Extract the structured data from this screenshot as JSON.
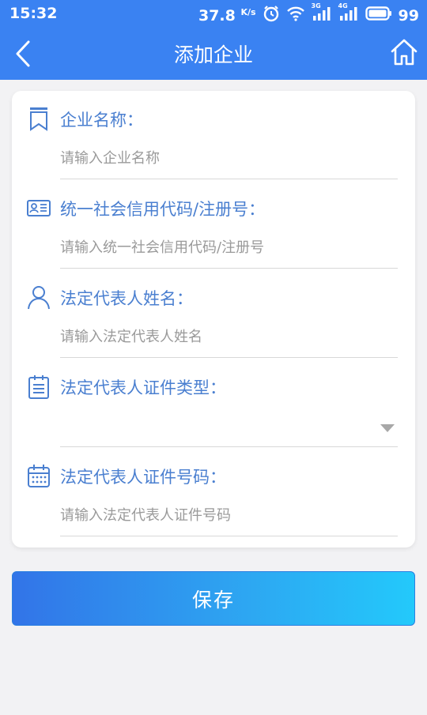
{
  "status_bar": {
    "time": "15:32",
    "net_speed": "37.8",
    "net_speed_unit": "K/s",
    "signal_1_label": "3G",
    "signal_2_label": "4G",
    "battery": "99"
  },
  "header": {
    "title": "添加企业",
    "back_icon": "chevron-left-icon",
    "home_icon": "home-icon"
  },
  "form": {
    "fields": [
      {
        "icon": "bookmark-icon",
        "label": "企业名称：",
        "placeholder": "请输入企业名称",
        "value": ""
      },
      {
        "icon": "id-card-icon",
        "label": "统一社会信用代码/注册号：",
        "placeholder": "请输入统一社会信用代码/注册号",
        "value": ""
      },
      {
        "icon": "user-icon",
        "label": "法定代表人姓名：",
        "placeholder": "请输入法定代表人姓名",
        "value": ""
      },
      {
        "icon": "clipboard-list-icon",
        "label": "法定代表人证件类型：",
        "selected": ""
      },
      {
        "icon": "calendar-icon",
        "label": "法定代表人证件号码：",
        "placeholder": "请输入法定代表人证件号码",
        "value": ""
      }
    ]
  },
  "actions": {
    "save_label": "保存"
  },
  "colors": {
    "header_bg": "#3a82f2",
    "accent_label": "#4a7fd0",
    "button_gradient_start": "#3274e8",
    "button_gradient_end": "#23c9fb"
  }
}
